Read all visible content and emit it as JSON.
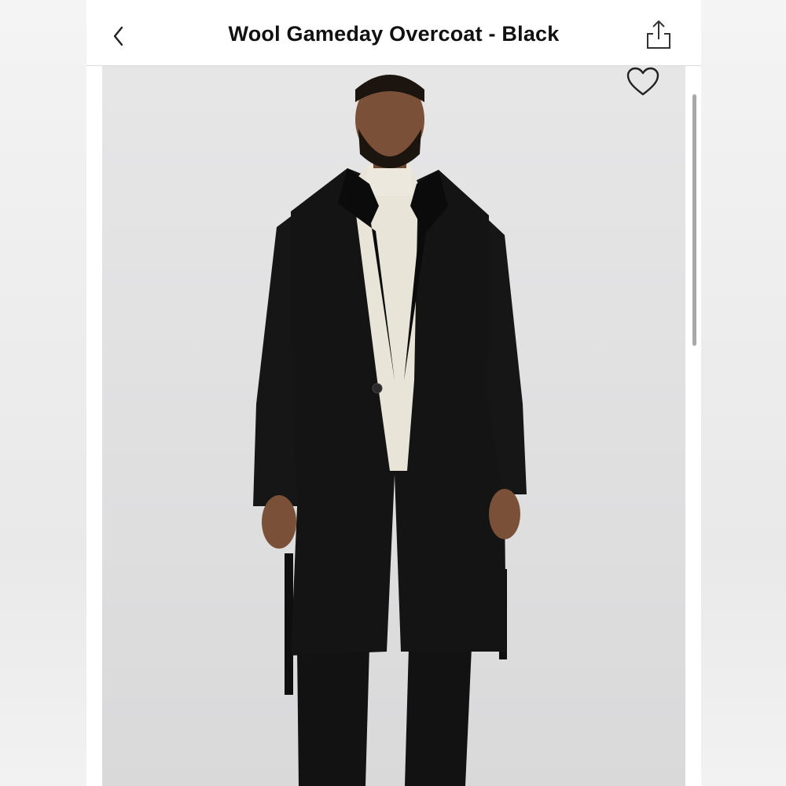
{
  "header": {
    "title": "Wool Gameday Overcoat - Black"
  },
  "icons": {
    "back": "chevron-left-icon",
    "share": "share-icon",
    "favorite": "heart-outline-icon"
  },
  "product_image": {
    "subject": "model wearing black wool overcoat over cream mock-neck top and black pants"
  },
  "colors": {
    "background": "#e3e3e4",
    "coat": "#141414",
    "top": "#e9e4d8"
  }
}
